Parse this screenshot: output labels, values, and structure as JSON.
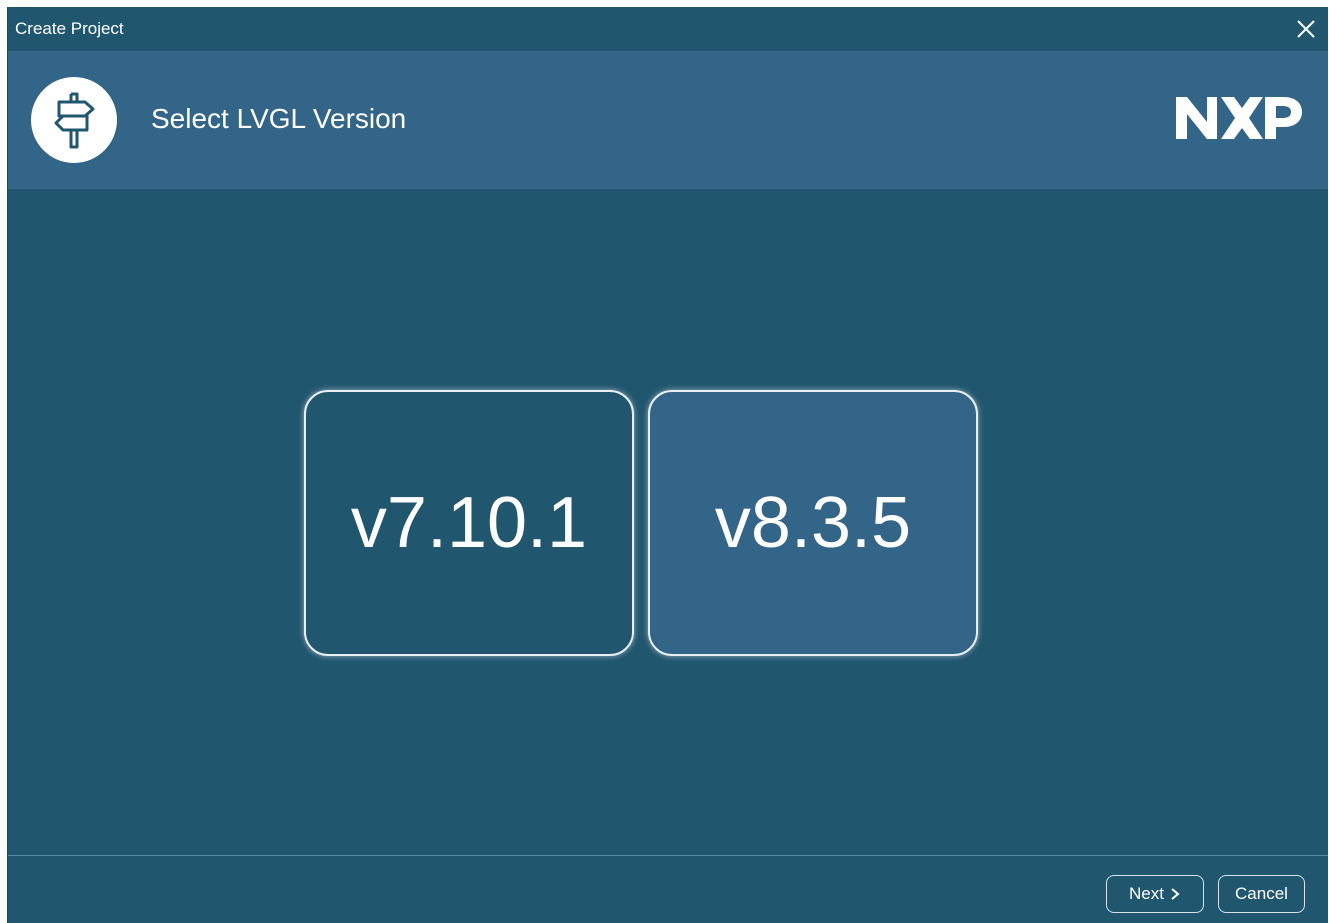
{
  "window": {
    "title": "Create Project"
  },
  "header": {
    "heading": "Select LVGL Version",
    "icon": "signpost-icon",
    "brand": "NXP"
  },
  "versions": [
    {
      "label": "v7.10.1",
      "selected": false
    },
    {
      "label": "v8.3.5",
      "selected": true
    }
  ],
  "footer": {
    "next_label": "Next",
    "cancel_label": "Cancel"
  },
  "colors": {
    "window_bg": "#21566f",
    "header_bg": "#336588",
    "selected_bg": "#336588"
  }
}
